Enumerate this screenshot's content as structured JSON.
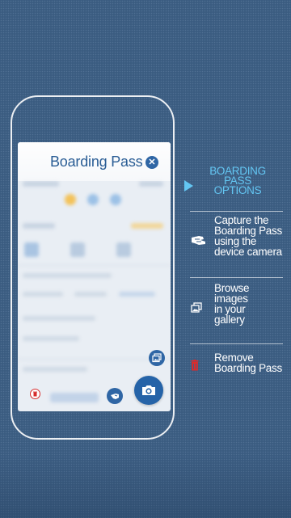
{
  "screen": {
    "sheet_title": "Boarding Pass"
  },
  "options_panel": {
    "title_lines": [
      "BOARDING",
      "PASS",
      "OPTIONS"
    ],
    "options": [
      {
        "icon": "hand-capture-icon",
        "lines": [
          "Capture the",
          "Boarding Pass",
          "using the",
          "device camera"
        ]
      },
      {
        "icon": "gallery-icon",
        "lines": [
          "Browse",
          "images",
          "in your",
          "gallery"
        ]
      },
      {
        "icon": "trash-icon",
        "lines": [
          "Remove",
          "Boarding Pass"
        ]
      }
    ]
  },
  "colors": {
    "background": "#3d5f85",
    "accent_blue": "#2563a8",
    "title_cyan": "#63c6f2",
    "remove_red": "#d62b2b"
  }
}
